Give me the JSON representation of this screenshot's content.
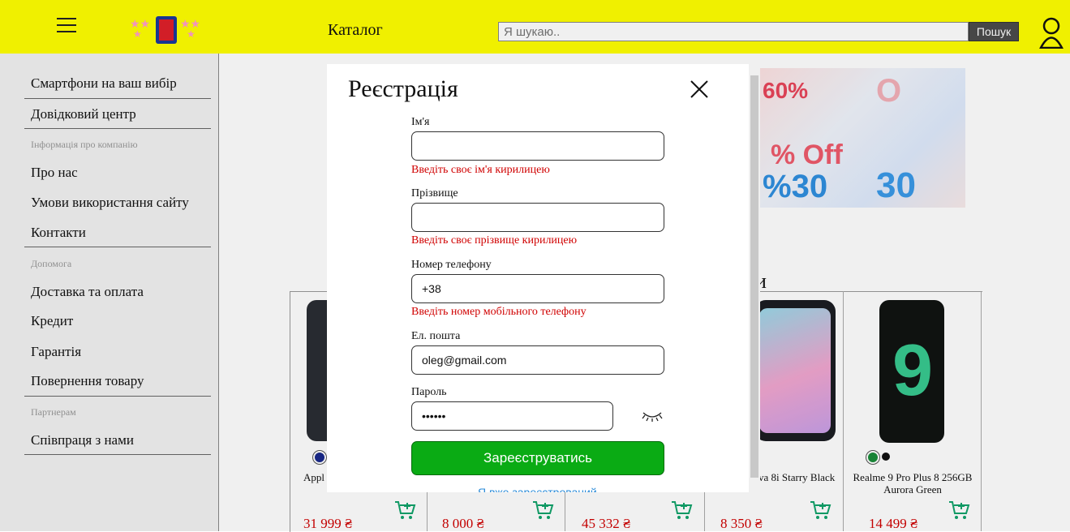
{
  "header": {
    "catalog_label": "Каталог",
    "search_placeholder": "Я шукаю..",
    "search_button": "Пошук"
  },
  "sidebar": {
    "items": [
      {
        "label": "Смартфони на ваш вибір"
      },
      {
        "label": "Довідковий центр"
      },
      {
        "section": "Інформація про компанію"
      },
      {
        "label": "Про нас"
      },
      {
        "label": "Умови використання сайту"
      },
      {
        "label": "Контакти"
      },
      {
        "section": "Допомога"
      },
      {
        "label": "Доставка та оплата"
      },
      {
        "label": "Кредит"
      },
      {
        "label": "Гарантія"
      },
      {
        "label": "Повернення товару"
      },
      {
        "section": "Партнерам"
      },
      {
        "label": "Співпраця з нами"
      }
    ]
  },
  "products": {
    "heading_partial": "ри",
    "cards": [
      {
        "title": "Appl",
        "price": "31 999 ₴"
      },
      {
        "title": "",
        "price": "8 000 ₴"
      },
      {
        "title": "",
        "price": "45 332 ₴"
      },
      {
        "title": "va 8i Starry Black",
        "price": "8 350 ₴"
      },
      {
        "title": "Realme 9 Pro Plus 8 256GB Aurora Green",
        "price": "14 499 ₴"
      }
    ]
  },
  "modal": {
    "title": "Реєстрація",
    "fields": {
      "first_name": {
        "label": "Ім'я",
        "value": "",
        "error": "Введіть своє ім'я кирилицею"
      },
      "last_name": {
        "label": "Прізвище",
        "value": "",
        "error": "Введіть своє прізвище кирилицею"
      },
      "phone": {
        "label": "Номер телефону",
        "value": "+38",
        "error": "Введіть номер мобільного телефону"
      },
      "email": {
        "label": "Ел. пошта",
        "value": "oleg@gmail.com"
      },
      "password": {
        "label": "Пароль",
        "value": "••••••"
      }
    },
    "submit_label": "Зареєструватись",
    "login_link": "Я вже зареєстрований"
  },
  "colors": {
    "header_bg": "#ffff00",
    "submit_bg": "#0aab14",
    "error": "#d00000",
    "price": "#d00000"
  }
}
